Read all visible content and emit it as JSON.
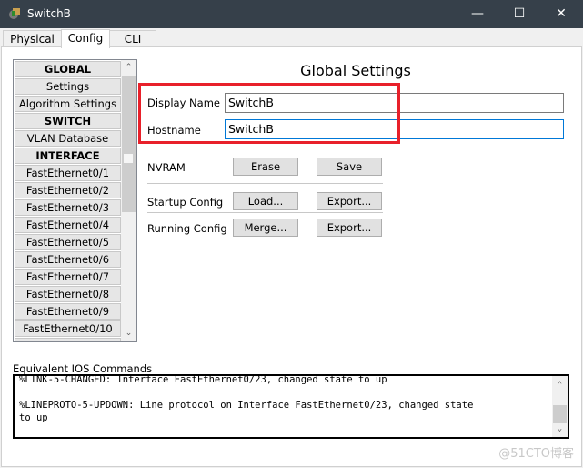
{
  "window": {
    "title": "SwitchB",
    "app_icon": "packet-tracer-switch-icon",
    "controls": [
      "minimize",
      "maximize",
      "close"
    ]
  },
  "tabs": [
    {
      "label": "Physical"
    },
    {
      "label": "Config",
      "active": true
    },
    {
      "label": "CLI"
    }
  ],
  "sidebar": {
    "items": [
      {
        "label": "GLOBAL",
        "header": true
      },
      {
        "label": "Settings"
      },
      {
        "label": "Algorithm Settings"
      },
      {
        "label": "SWITCH",
        "header": true
      },
      {
        "label": "VLAN Database"
      },
      {
        "label": "INTERFACE",
        "header": true
      },
      {
        "label": "FastEthernet0/1"
      },
      {
        "label": "FastEthernet0/2"
      },
      {
        "label": "FastEthernet0/3"
      },
      {
        "label": "FastEthernet0/4"
      },
      {
        "label": "FastEthernet0/5"
      },
      {
        "label": "FastEthernet0/6"
      },
      {
        "label": "FastEthernet0/7"
      },
      {
        "label": "FastEthernet0/8"
      },
      {
        "label": "FastEthernet0/9"
      },
      {
        "label": "FastEthernet0/10"
      }
    ]
  },
  "main": {
    "title": "Global Settings",
    "display_name": {
      "label": "Display Name",
      "value": "SwitchB"
    },
    "hostname": {
      "label": "Hostname",
      "value": "SwitchB"
    },
    "nvram": {
      "label": "NVRAM",
      "erase": "Erase",
      "save": "Save"
    },
    "startup": {
      "label": "Startup Config",
      "load": "Load...",
      "export": "Export..."
    },
    "running": {
      "label": "Running Config",
      "merge": "Merge...",
      "export": "Export..."
    },
    "highlight_color": "#e8202a"
  },
  "ios": {
    "label": "Equivalent IOS Commands",
    "lines": [
      "%LINK-5-CHANGED: Interface FastEthernet0/23, changed state to up",
      "",
      "%LINEPROTO-5-UPDOWN: Line protocol on Interface FastEthernet0/23, changed state",
      "to up"
    ]
  },
  "watermark": "@51CTO博客"
}
